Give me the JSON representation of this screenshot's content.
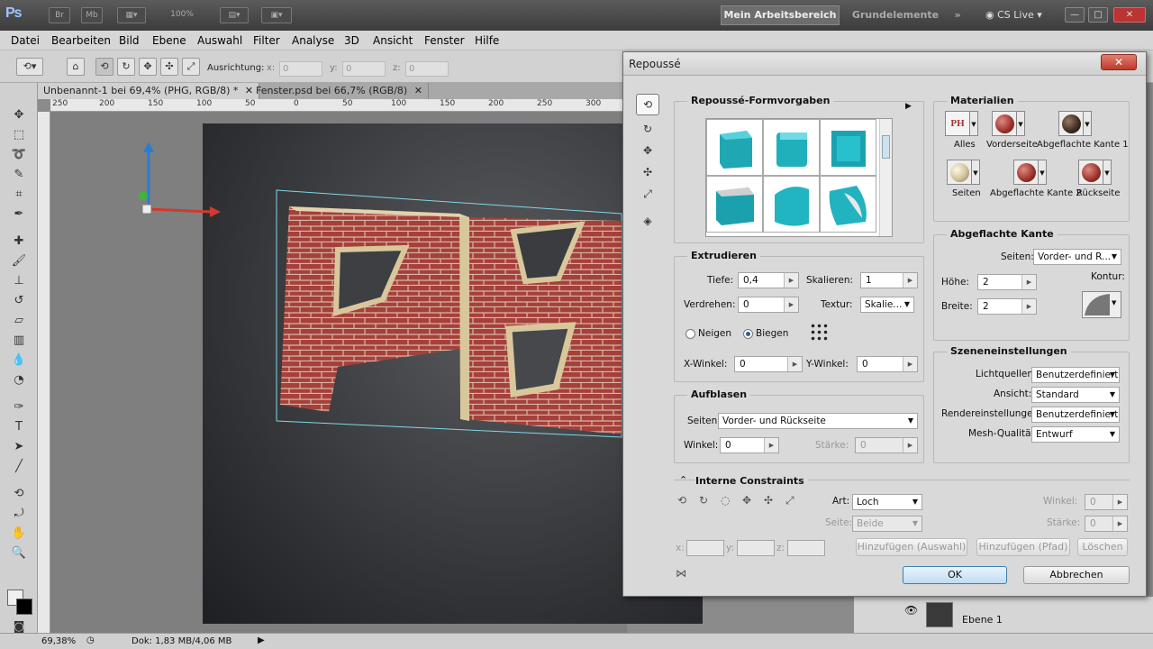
{
  "app": {
    "logo": "Ps",
    "zoom_box": "100%",
    "workspace_active": "Mein Arbeitsbereich",
    "workspace_other": "Grundelemente",
    "more": "»",
    "cs_live": "CS Live",
    "win_controls": [
      "—",
      "□",
      "✕"
    ]
  },
  "menu": [
    "Datei",
    "Bearbeiten",
    "Bild",
    "Ebene",
    "Auswahl",
    "Filter",
    "Analyse",
    "3D",
    "Ansicht",
    "Fenster",
    "Hilfe"
  ],
  "options": {
    "orientation_label": "Ausrichtung:",
    "x_label": "x:",
    "x_value": "0",
    "y_label": "y:",
    "y_value": "0",
    "z_label": "z:",
    "z_value": "0"
  },
  "tabs": [
    {
      "label": "Unbenannt-1 bei 69,4% (PHG, RGB/8) *",
      "close": "✕"
    },
    {
      "label": "Fenster.psd bei 66,7% (RGB/8)",
      "close": "✕"
    }
  ],
  "ruler_top": [
    "250",
    "200",
    "150",
    "100",
    "50",
    "0",
    "50",
    "100",
    "150",
    "200",
    "250",
    "300"
  ],
  "status": {
    "zoom": "69,38%",
    "doc": "Dok: 1,83 MB/4,06 MB"
  },
  "layers": {
    "name": "Ebene 1"
  },
  "dialog": {
    "title": "Repoussé",
    "close": "✕",
    "presets": {
      "title": "Repoussé-Formvorgaben"
    },
    "extrude": {
      "title": "Extrudieren",
      "depth_label": "Tiefe:",
      "depth": "0,4",
      "scale_label": "Skalieren:",
      "scale": "1",
      "twist_label": "Verdrehen:",
      "twist": "0",
      "texture_label": "Textur:",
      "texture": "Skalie...",
      "shear_label": "Neigen",
      "bend_label": "Biegen",
      "xangle_label": "X-Winkel:",
      "xangle": "0",
      "yangle_label": "Y-Winkel:",
      "yangle": "0"
    },
    "inflate": {
      "title": "Aufblasen",
      "sides_label": "Seiten:",
      "sides": "Vorder- und Rückseite",
      "angle_label": "Winkel:",
      "angle": "0",
      "strength_label": "Stärke:",
      "strength": "0"
    },
    "materials": {
      "title": "Materialien",
      "items": [
        "Alles",
        "Vorderseite",
        "Abgeflachte Kante 1",
        "Seiten",
        "Abgeflachte Kante 2",
        "Rückseite"
      ]
    },
    "bevel": {
      "title": "Abgeflachte Kante",
      "sides_label": "Seiten:",
      "sides": "Vorder- und R...",
      "height_label": "Höhe:",
      "height": "2",
      "width_label": "Breite:",
      "width": "2",
      "contour_label": "Kontur:"
    },
    "scene": {
      "title": "Szeneneinstellungen",
      "lights_label": "Lichtquellen:",
      "lights": "Benutzerdefiniert",
      "view_label": "Ansicht:",
      "view": "Standard",
      "render_label": "Rendereinstellungen:",
      "render": "Benutzerdefiniert",
      "mesh_label": "Mesh-Qualität:",
      "mesh": "Entwurf"
    },
    "constraints": {
      "title": "Interne Constraints",
      "type_label": "Art:",
      "type": "Loch",
      "side_label": "Seite:",
      "side": "Beide",
      "angle_label": "Winkel:",
      "angle": "0",
      "strength_label": "Stärke:",
      "strength": "0",
      "x_label": "x:",
      "y_label": "y:",
      "z_label": "z:",
      "add_sel": "Hinzufügen (Auswahl)",
      "add_path": "Hinzufügen (Pfad)",
      "delete": "Löschen"
    },
    "ok": "OK",
    "cancel": "Abbrechen"
  },
  "colors": {
    "accent_ok": "#bfdcf2",
    "brick": "#a33a34",
    "bevel": "#d9c79c"
  }
}
